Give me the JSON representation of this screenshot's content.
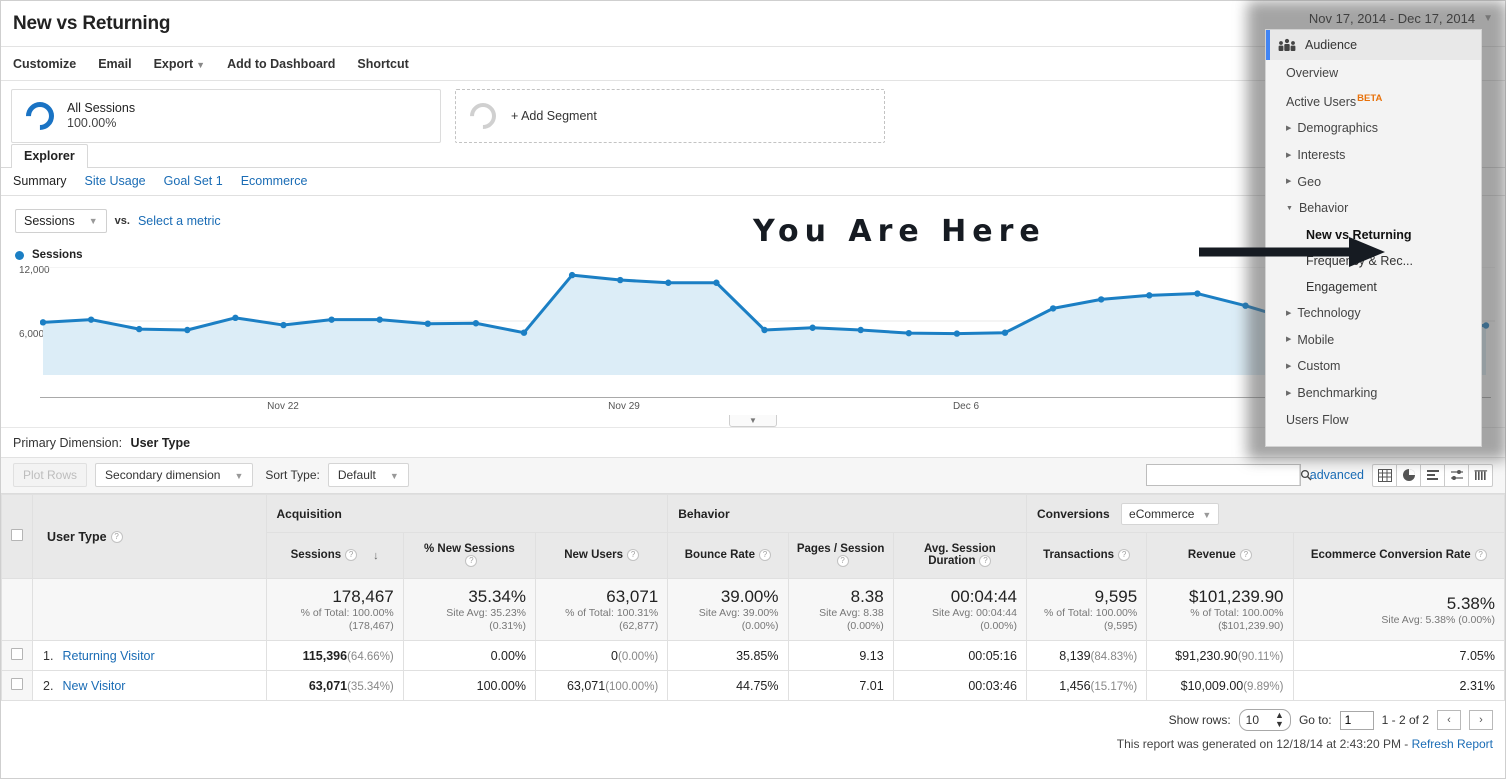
{
  "header": {
    "title": "New vs Returning",
    "date_range": "Nov 17, 2014 - Dec 17, 2014"
  },
  "actionbar": {
    "items": [
      {
        "label": "Customize",
        "caret": false
      },
      {
        "label": "Email",
        "caret": false
      },
      {
        "label": "Export",
        "caret": true
      },
      {
        "label": "Add to Dashboard",
        "caret": false
      },
      {
        "label": "Shortcut",
        "caret": false
      }
    ]
  },
  "segments": {
    "all_sessions_label": "All Sessions",
    "all_sessions_pct": "100.00%",
    "add_segment_label": "+ Add Segment"
  },
  "tabs": {
    "explorer": "Explorer",
    "subtabs": [
      {
        "label": "Summary",
        "active": true
      },
      {
        "label": "Site Usage",
        "active": false
      },
      {
        "label": "Goal Set 1",
        "active": false
      },
      {
        "label": "Ecommerce",
        "active": false
      }
    ]
  },
  "chart_controls": {
    "metric_select": "Sessions",
    "vs_label": "vs.",
    "select_metric_link": "Select a metric",
    "legend_label": "Sessions"
  },
  "annotation": {
    "text": "You Are Here"
  },
  "primary_dimension": {
    "label": "Primary Dimension:",
    "value": "User Type"
  },
  "controls": {
    "plot_rows": "Plot Rows",
    "secondary_dimension": "Secondary dimension",
    "sort_type_label": "Sort Type:",
    "sort_type_value": "Default",
    "search_placeholder": "",
    "search_value": "",
    "advanced_link": "advanced",
    "view_icons": [
      "table-view-icon",
      "pie-view-icon",
      "bar-view-icon",
      "comparison-view-icon",
      "pivot-view-icon"
    ]
  },
  "table": {
    "groups": [
      {
        "label": "",
        "span": 2
      },
      {
        "label": "Acquisition",
        "span": 3
      },
      {
        "label": "Behavior",
        "span": 3
      },
      {
        "label": "Conversions",
        "span": 3,
        "select": "eCommerce"
      }
    ],
    "dimension_header": "User Type",
    "columns": [
      {
        "label": "Sessions",
        "sorted": true
      },
      {
        "label": "% New Sessions",
        "sorted": false
      },
      {
        "label": "New Users",
        "sorted": false
      },
      {
        "label": "Bounce Rate",
        "sorted": false
      },
      {
        "label": "Pages / Session",
        "sorted": false
      },
      {
        "label": "Avg. Session Duration",
        "sorted": false
      },
      {
        "label": "Transactions",
        "sorted": false
      },
      {
        "label": "Revenue",
        "sorted": false
      },
      {
        "label": "Ecommerce Conversion Rate",
        "sorted": false
      }
    ],
    "totals": [
      {
        "big": "178,467",
        "sub1": "% of Total: 100.00%",
        "sub2": "(178,467)"
      },
      {
        "big": "35.34%",
        "sub1": "Site Avg: 35.23%",
        "sub2": "(0.31%)"
      },
      {
        "big": "63,071",
        "sub1": "% of Total: 100.31%",
        "sub2": "(62,877)"
      },
      {
        "big": "39.00%",
        "sub1": "Site Avg: 39.00%",
        "sub2": "(0.00%)"
      },
      {
        "big": "8.38",
        "sub1": "Site Avg: 8.38",
        "sub2": "(0.00%)"
      },
      {
        "big": "00:04:44",
        "sub1": "Site Avg: 00:04:44",
        "sub2": "(0.00%)"
      },
      {
        "big": "9,595",
        "sub1": "% of Total: 100.00%",
        "sub2": "(9,595)"
      },
      {
        "big": "$101,239.90",
        "sub1": "% of Total: 100.00%",
        "sub2": "($101,239.90)"
      },
      {
        "big": "5.38%",
        "sub1": "Site Avg: 5.38% (0.00%)",
        "sub2": ""
      }
    ],
    "rows": [
      {
        "index": "1.",
        "name": "Returning Visitor",
        "cells": [
          {
            "main": "115,396",
            "pct": "(64.66%)",
            "bold": true
          },
          {
            "main": "0.00%",
            "pct": "",
            "bold": false
          },
          {
            "main": "0",
            "pct": "(0.00%)",
            "bold": false
          },
          {
            "main": "35.85%",
            "pct": "",
            "bold": false
          },
          {
            "main": "9.13",
            "pct": "",
            "bold": false
          },
          {
            "main": "00:05:16",
            "pct": "",
            "bold": false
          },
          {
            "main": "8,139",
            "pct": "(84.83%)",
            "bold": false
          },
          {
            "main": "$91,230.90",
            "pct": "(90.11%)",
            "bold": false
          },
          {
            "main": "7.05%",
            "pct": "",
            "bold": false
          }
        ]
      },
      {
        "index": "2.",
        "name": "New Visitor",
        "cells": [
          {
            "main": "63,071",
            "pct": "(35.34%)",
            "bold": true
          },
          {
            "main": "100.00%",
            "pct": "",
            "bold": false
          },
          {
            "main": "63,071",
            "pct": "(100.00%)",
            "bold": false
          },
          {
            "main": "44.75%",
            "pct": "",
            "bold": false
          },
          {
            "main": "7.01",
            "pct": "",
            "bold": false
          },
          {
            "main": "00:03:46",
            "pct": "",
            "bold": false
          },
          {
            "main": "1,456",
            "pct": "(15.17%)",
            "bold": false
          },
          {
            "main": "$10,009.00",
            "pct": "(9.89%)",
            "bold": false
          },
          {
            "main": "2.31%",
            "pct": "",
            "bold": false
          }
        ]
      }
    ]
  },
  "footer": {
    "show_rows_label": "Show rows:",
    "show_rows_value": "10",
    "goto_label": "Go to:",
    "goto_value": "1",
    "range_label": "1 - 2 of 2",
    "prev": "‹",
    "next": "›",
    "generated_text": "This report was generated on 12/18/14 at 2:43:20 PM - ",
    "refresh_link": "Refresh Report"
  },
  "menu": {
    "title": "Audience",
    "items": [
      {
        "label": "Overview",
        "type": "leaf",
        "level": 0
      },
      {
        "label": "Active Users",
        "type": "leaf",
        "level": 0,
        "badge": "BETA"
      },
      {
        "label": "Demographics",
        "type": "collapsed",
        "level": 0
      },
      {
        "label": "Interests",
        "type": "collapsed",
        "level": 0
      },
      {
        "label": "Geo",
        "type": "collapsed",
        "level": 0
      },
      {
        "label": "Behavior",
        "type": "expanded",
        "level": 0
      },
      {
        "label": "New vs Returning",
        "type": "child-current",
        "level": 1
      },
      {
        "label": "Frequency & Rec...",
        "type": "child",
        "level": 1
      },
      {
        "label": "Engagement",
        "type": "child",
        "level": 1
      },
      {
        "label": "Technology",
        "type": "collapsed",
        "level": 0
      },
      {
        "label": "Mobile",
        "type": "collapsed",
        "level": 0
      },
      {
        "label": "Custom",
        "type": "collapsed",
        "level": 0
      },
      {
        "label": "Benchmarking",
        "type": "collapsed",
        "level": 0
      },
      {
        "label": "Users Flow",
        "type": "leaf",
        "level": 0
      }
    ]
  },
  "chart_data": {
    "type": "area",
    "title": "Sessions",
    "xlabel": "",
    "ylabel": "Sessions",
    "ylim": [
      0,
      12000
    ],
    "yticks": [
      6000,
      12000
    ],
    "ytick_labels": [
      "6,000",
      "12,000"
    ],
    "grid": true,
    "legend": [
      "Sessions"
    ],
    "legend_position": "top-left",
    "series_color": "#1b7fc4",
    "fill_color": "#dcedf7",
    "x": [
      "Nov 17",
      "Nov 18",
      "Nov 19",
      "Nov 20",
      "Nov 21",
      "Nov 22",
      "Nov 23",
      "Nov 24",
      "Nov 25",
      "Nov 26",
      "Nov 27",
      "Nov 28",
      "Nov 29",
      "Nov 30",
      "Dec 1",
      "Dec 2",
      "Dec 3",
      "Dec 4",
      "Dec 5",
      "Dec 6",
      "Dec 7",
      "Dec 8",
      "Dec 9",
      "Dec 10",
      "Dec 11",
      "Dec 12",
      "Dec 13",
      "Dec 14",
      "Dec 15",
      "Dec 16",
      "Dec 17"
    ],
    "xtick_labels": [
      "Nov 22",
      "Nov 29",
      "Dec 6"
    ],
    "values": [
      5850,
      6150,
      5100,
      5000,
      6350,
      5550,
      6150,
      6150,
      5700,
      5750,
      4700,
      11100,
      10550,
      10250,
      10250,
      5000,
      5250,
      5000,
      4650,
      4600,
      4700,
      7400,
      8400,
      8850,
      9050,
      7700,
      6100,
      6200,
      5850,
      5400,
      5500
    ]
  }
}
